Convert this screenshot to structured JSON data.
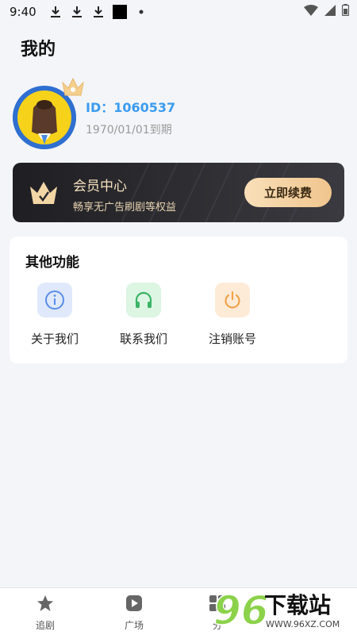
{
  "status_bar": {
    "time": "9:40"
  },
  "header": {
    "title": "我的"
  },
  "profile": {
    "id_text": "ID：1060537",
    "expiry_text": "1970/01/01到期"
  },
  "vip": {
    "title": "会员中心",
    "subtitle": "畅享无广告刷剧等权益",
    "button_label": "立即续费"
  },
  "functions": {
    "title": "其他功能",
    "items": [
      {
        "label": "关于我们",
        "icon": "info-icon",
        "bg": "#dfe9fb",
        "fg": "#5b8de8"
      },
      {
        "label": "联系我们",
        "icon": "headphones-icon",
        "bg": "#ddf5e3",
        "fg": "#3bb366"
      },
      {
        "label": "注销账号",
        "icon": "power-icon",
        "bg": "#fdebd8",
        "fg": "#f0a24a"
      }
    ]
  },
  "tab_bar": {
    "tabs": [
      {
        "label": "追剧",
        "icon": "star-icon"
      },
      {
        "label": "广场",
        "icon": "play-icon"
      },
      {
        "label": "分",
        "icon": "grid-icon"
      }
    ]
  },
  "watermark": {
    "text": "下载站",
    "number": "96",
    "url": "WWW.96XZ.COM"
  }
}
